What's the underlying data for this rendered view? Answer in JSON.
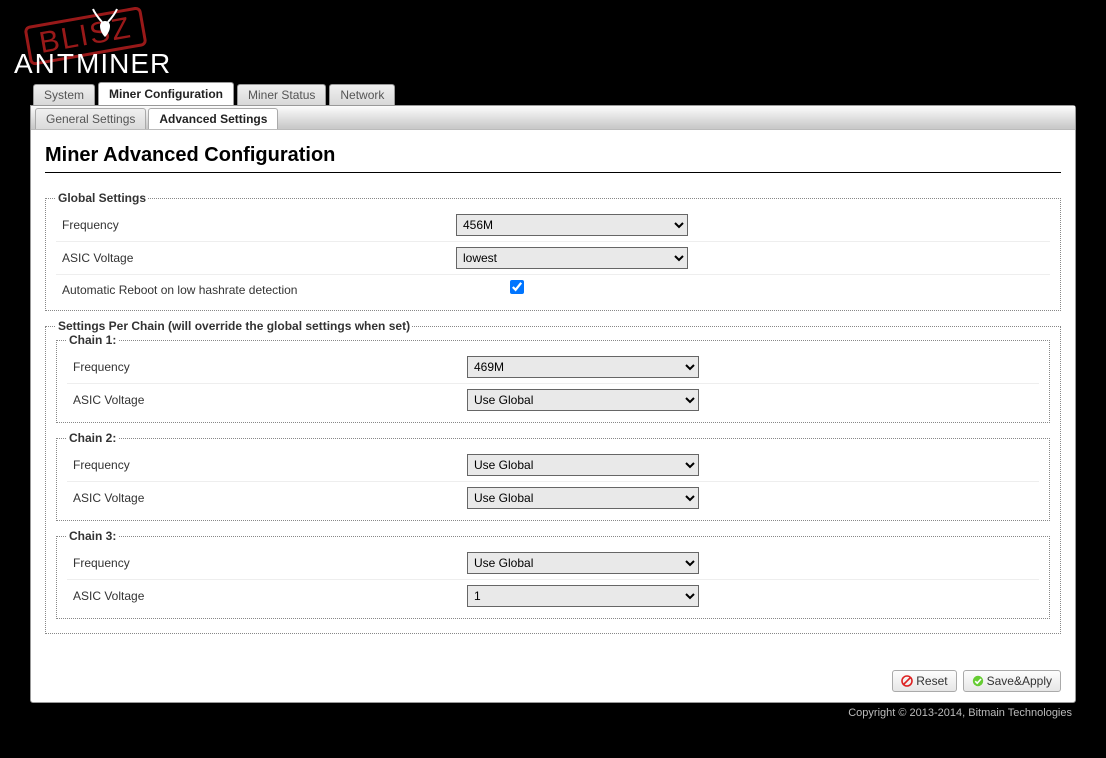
{
  "brand": {
    "ant": "ANT",
    "miner": "MINER",
    "stamp": "BLISZ"
  },
  "tabs_l1": {
    "t0": "System",
    "t1": "Miner Configuration",
    "t2": "Miner Status",
    "t3": "Network"
  },
  "tabs_l2": {
    "t0": "General Settings",
    "t1": "Advanced Settings"
  },
  "page_title": "Miner Advanced Configuration",
  "global": {
    "legend": "Global Settings",
    "freq_label": "Frequency",
    "freq_value": "456M",
    "volt_label": "ASIC Voltage",
    "volt_value": "lowest",
    "reboot_label": "Automatic Reboot on low hashrate detection",
    "reboot_checked": true
  },
  "per_chain_legend": "Settings Per Chain (will override the global settings when set)",
  "chain1": {
    "legend": "Chain 1:",
    "freq_label": "Frequency",
    "freq_value": "469M",
    "volt_label": "ASIC Voltage",
    "volt_value": "Use Global"
  },
  "chain2": {
    "legend": "Chain 2:",
    "freq_label": "Frequency",
    "freq_value": "Use Global",
    "volt_label": "ASIC Voltage",
    "volt_value": "Use Global"
  },
  "chain3": {
    "legend": "Chain 3:",
    "freq_label": "Frequency",
    "freq_value": "Use Global",
    "volt_label": "ASIC Voltage",
    "volt_value": "1"
  },
  "buttons": {
    "reset": "Reset",
    "save": "Save&Apply"
  },
  "footer": "Copyright © 2013-2014, Bitmain Technologies"
}
